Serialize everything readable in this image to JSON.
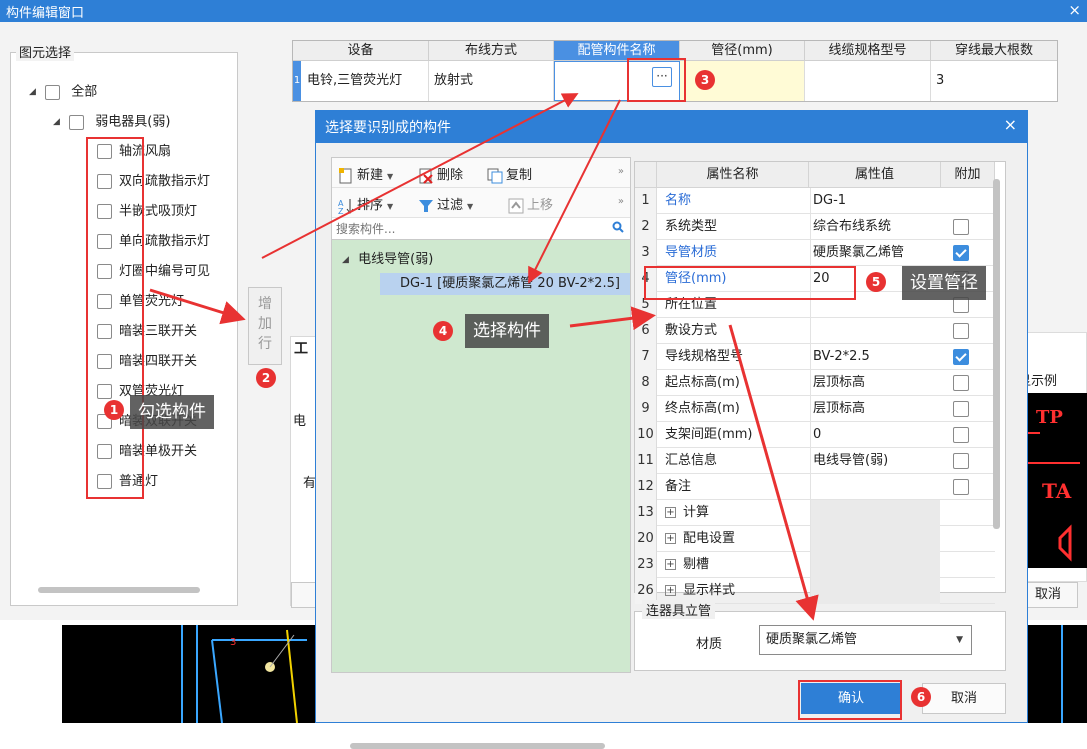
{
  "outer_window": {
    "title": "构件编辑窗口",
    "close": "×"
  },
  "left_panel": {
    "group_title": "图元选择",
    "root": "全部",
    "category": "弱电器具(弱)",
    "items": [
      "轴流风扇",
      "双向疏散指示灯",
      "半嵌式吸顶灯",
      "单向疏散指示灯",
      "灯圈中编号可见",
      "单管荧光灯",
      "暗装三联开关",
      "暗装四联开关",
      "双管荧光灯",
      "暗装双联开关",
      "暗装单极开关",
      "普通灯"
    ],
    "add_row_button": "增加行"
  },
  "top_grid": {
    "headers": [
      "设备",
      "布线方式",
      "配管构件名称",
      "管径(mm)",
      "线缆规格型号",
      "穿线最大根数"
    ],
    "row": {
      "num": "1",
      "device": "电铃,三管荧光灯",
      "wiring": "放射式",
      "pipe_name": "",
      "diameter": "",
      "cable": "",
      "max_wires": "3"
    },
    "dots": "···"
  },
  "behind": {
    "text1": "工",
    "text2": "电",
    "text3": "有",
    "legend": "显示例",
    "cancel": "取消"
  },
  "dialog": {
    "title": "选择要识别成的构件",
    "close": "×",
    "toolbar": {
      "new": "新建",
      "delete": "删除",
      "copy": "复制",
      "sort": "排序",
      "filter": "过滤",
      "move_up": "上移",
      "more": "»"
    },
    "search_placeholder": "搜索构件...",
    "tree": {
      "category": "电线导管(弱)",
      "item": "DG-1 [硬质聚氯乙烯管 20 BV-2*2.5]"
    },
    "prop_grid": {
      "headers": [
        "属性名称",
        "属性值",
        "附加"
      ],
      "rows": [
        {
          "num": "1",
          "name": "名称",
          "value": "DG-1"
        },
        {
          "num": "2",
          "name": "系统类型",
          "value": "综合布线系统"
        },
        {
          "num": "3",
          "name": "导管材质",
          "value": "硬质聚氯乙烯管"
        },
        {
          "num": "4",
          "name": "管径(mm)",
          "value": "20"
        },
        {
          "num": "5",
          "name": "所在位置",
          "value": ""
        },
        {
          "num": "6",
          "name": "敷设方式",
          "value": ""
        },
        {
          "num": "7",
          "name": "导线规格型号",
          "value": "BV-2*2.5"
        },
        {
          "num": "8",
          "name": "起点标高(m)",
          "value": "层顶标高"
        },
        {
          "num": "9",
          "name": "终点标高(m)",
          "value": "层顶标高"
        },
        {
          "num": "10",
          "name": "支架间距(mm)",
          "value": "0"
        },
        {
          "num": "11",
          "name": "汇总信息",
          "value": "电线导管(弱)"
        },
        {
          "num": "12",
          "name": "备注",
          "value": ""
        },
        {
          "num": "13",
          "name": "计算",
          "value": ""
        },
        {
          "num": "20",
          "name": "配电设置",
          "value": ""
        },
        {
          "num": "23",
          "name": "剔槽",
          "value": ""
        },
        {
          "num": "26",
          "name": "显示样式",
          "value": ""
        }
      ]
    },
    "riser": {
      "group_title": "连器具立管",
      "material_label": "材质",
      "material_value": "硬质聚氯乙烯管"
    },
    "confirm": "确认",
    "cancel": "取消"
  },
  "annotations": {
    "badges": [
      "1",
      "2",
      "3",
      "4",
      "5",
      "6"
    ],
    "callout_1": "勾选构件",
    "callout_4": "选择构件",
    "callout_5": "设置管径"
  },
  "colors": {
    "titlebar": "#2e7fd6",
    "annotation_red": "#e83232",
    "tree_bg": "#cfe8cf",
    "selected_row": "#b9d2ef"
  }
}
